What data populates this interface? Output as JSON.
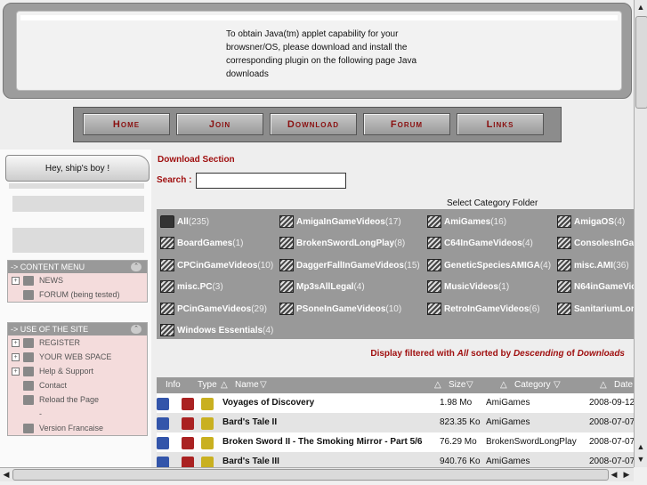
{
  "applet_message": "To obtain Java(tm) applet capability for your browsner/OS, please download and install the corresponding plugin on the following page Java downloads",
  "nav": [
    "Home",
    "Join",
    "Download",
    "Forum",
    "Links"
  ],
  "sidebar": {
    "greeting": "Hey, ship's boy !",
    "content_menu": {
      "title": "-> CONTENT MENU",
      "items": [
        "NEWS",
        "FORUM (being tested)"
      ]
    },
    "use_site": {
      "title": "-> USE OF THE SITE",
      "items": [
        "REGISTER",
        "YOUR WEB SPACE",
        "Help & Support",
        "Contact",
        "Reload the Page",
        "-",
        "Version Francaise"
      ]
    }
  },
  "main": {
    "section_title": "Download Section",
    "search_label": "Search :",
    "search_value": "",
    "select_category": "Select Category Folder",
    "categories": [
      {
        "name": "All",
        "count": "(235)"
      },
      {
        "name": "AmigaInGameVideos",
        "count": "(17)"
      },
      {
        "name": "AmiGames",
        "count": "(16)"
      },
      {
        "name": "AmigaOS",
        "count": "(4)"
      },
      {
        "name": "BoardGames",
        "count": "(1)"
      },
      {
        "name": "BrokenSwordLongPlay",
        "count": "(8)"
      },
      {
        "name": "C64InGameVideos",
        "count": "(4)"
      },
      {
        "name": "ConsolesInGa",
        "count": ""
      },
      {
        "name": "CPCinGameVideos",
        "count": "(10)"
      },
      {
        "name": "DaggerFallInGameVideos",
        "count": "(15)"
      },
      {
        "name": "GeneticSpeciesAMIGA",
        "count": "(4)"
      },
      {
        "name": "misc.AMI",
        "count": "(36)"
      },
      {
        "name": "misc.PC",
        "count": "(3)"
      },
      {
        "name": "Mp3sAllLegal",
        "count": "(4)"
      },
      {
        "name": "MusicVideos",
        "count": "(1)"
      },
      {
        "name": "N64inGameVid",
        "count": ""
      },
      {
        "name": "PCinGameVideos",
        "count": "(29)"
      },
      {
        "name": "PSoneInGameVideos",
        "count": "(10)"
      },
      {
        "name": "RetroInGameVideos",
        "count": "(6)"
      },
      {
        "name": "SanitariumLon",
        "count": ""
      },
      {
        "name": "Windows Essentials",
        "count": "(4)"
      }
    ],
    "filter": {
      "prefix": "Display filtered with",
      "filter_name": "All",
      "sorted_by": "sorted by",
      "order": "Descending",
      "of": "of",
      "field": "Downloads"
    },
    "table_headers": {
      "info": "Info",
      "type": "Type",
      "name": "Name",
      "size": "Size",
      "category": "Category",
      "date": "Date"
    },
    "rows": [
      {
        "name": "Voyages of Discovery",
        "size": "1.98 Mo",
        "category": "AmiGames",
        "date": "2008-09-12"
      },
      {
        "name": "Bard's Tale II",
        "size": "823.35 Ko",
        "category": "AmiGames",
        "date": "2008-07-07"
      },
      {
        "name": "Broken Sword II - The Smoking Mirror - Part 5/6",
        "size": "76.29 Mo",
        "category": "BrokenSwordLongPlay",
        "date": "2008-07-07"
      },
      {
        "name": "Bard's Tale III",
        "size": "940.76 Ko",
        "category": "AmiGames",
        "date": "2008-07-07"
      }
    ]
  }
}
